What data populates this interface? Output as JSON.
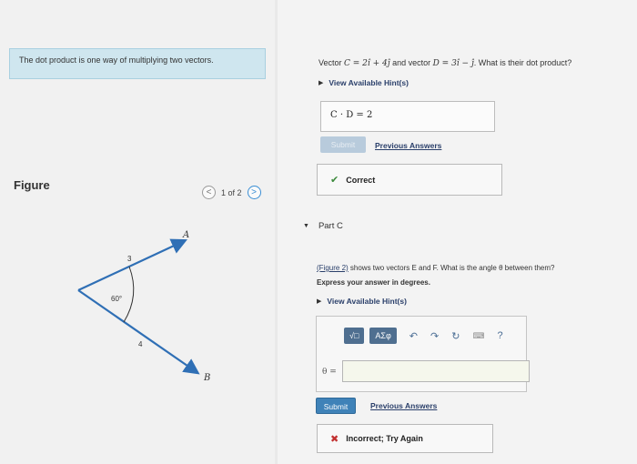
{
  "intro": {
    "text": "The dot product is one way of multiplying two vectors."
  },
  "figure": {
    "label": "Figure",
    "pager_text": "1 of 2",
    "prev_glyph": "<",
    "next_glyph": ">",
    "vector_a": "A",
    "vector_b": "B",
    "angle_label": "60°",
    "len_a": "3",
    "len_b": "4"
  },
  "part_b": {
    "question_pre": "Vector ",
    "vec_c": "C = 2î + 4ĵ",
    "question_mid": " and vector ",
    "vec_d": "D = 3î − ĵ",
    "question_post": ". What is their dot product?",
    "hints_label": "View Available Hint(s)",
    "answer_value": "C · D = 2",
    "submit_label": "Submit",
    "prev_answers_label": "Previous Answers",
    "feedback_label": "Correct"
  },
  "part_c": {
    "title": "Part C",
    "fig_link": "(Figure 2)",
    "question_text": " shows two vectors E and F. What is the angle θ between them?",
    "express_text": "Express your answer in degrees.",
    "hints_label": "View Available Hint(s)",
    "tool_sqrt": "√□",
    "tool_greek": "ΑΣφ",
    "theta_label": "θ =",
    "submit_label": "Submit",
    "prev_answers_label": "Previous Answers",
    "feedback_label": "Incorrect; Try Again"
  },
  "colors": {
    "accent": "#3f82b8",
    "vector": "#2f6fb5",
    "correct": "#3c8a3c",
    "incorrect": "#c23030"
  }
}
